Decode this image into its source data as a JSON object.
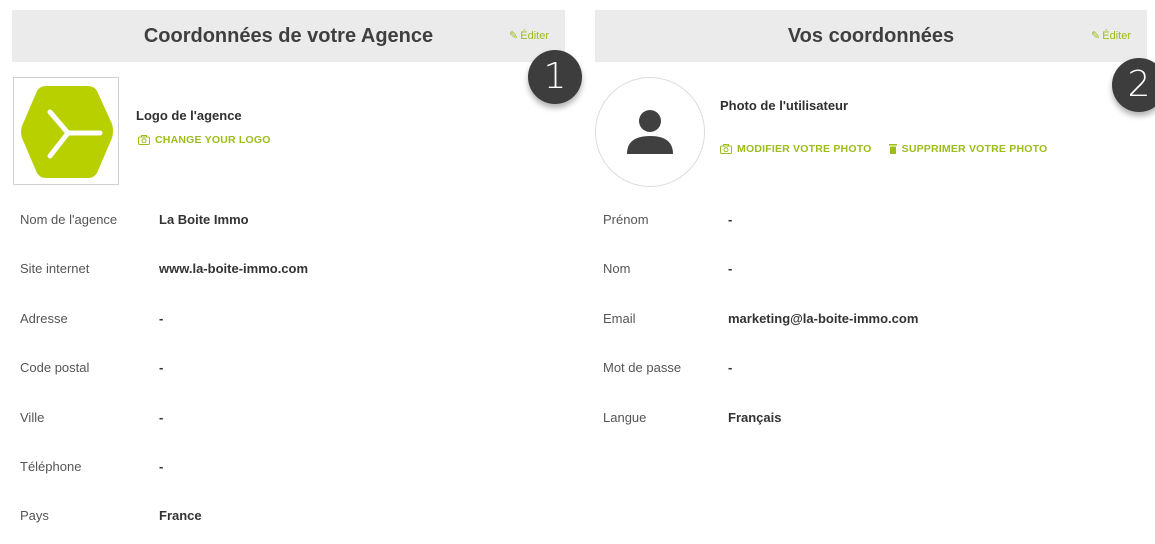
{
  "agency_panel": {
    "title": "Coordonnées de votre Agence",
    "edit_label": "Éditer",
    "step_number": "1",
    "logo_title": "Logo de l'agence",
    "change_logo_label": "CHANGE YOUR LOGO",
    "fields": [
      {
        "label": "Nom de l'agence",
        "value": "La Boite Immo"
      },
      {
        "label": "Site internet",
        "value": "www.la-boite-immo.com"
      },
      {
        "label": "Adresse",
        "value": "-"
      },
      {
        "label": "Code postal",
        "value": "-"
      },
      {
        "label": "Ville",
        "value": "-"
      },
      {
        "label": "Téléphone",
        "value": "-"
      },
      {
        "label": "Pays",
        "value": "France"
      }
    ]
  },
  "user_panel": {
    "title": "Vos coordonnées",
    "edit_label": "Éditer",
    "step_number": "2",
    "photo_title": "Photo de l'utilisateur",
    "modify_photo_label": "MODIFIER VOTRE PHOTO",
    "delete_photo_label": "SUPPRIMER VOTRE PHOTO",
    "fields": [
      {
        "label": "Prénom",
        "value": "-"
      },
      {
        "label": "Nom",
        "value": "-"
      },
      {
        "label": "Email",
        "value": "marketing@la-boite-immo.com"
      },
      {
        "label": "Mot de passe",
        "value": "-"
      },
      {
        "label": "Langue",
        "value": "Français"
      }
    ]
  },
  "icons": {
    "edit": "pencil-icon",
    "camera": "camera-icon",
    "trash": "trash-icon",
    "user": "user-silhouette-icon",
    "logo": "hexagon-logo"
  },
  "colors": {
    "accent": "#9cbd1a",
    "header_bg": "#ebebeb",
    "badge_bg": "#3d3d3d",
    "logo_green": "#b8cf00"
  }
}
